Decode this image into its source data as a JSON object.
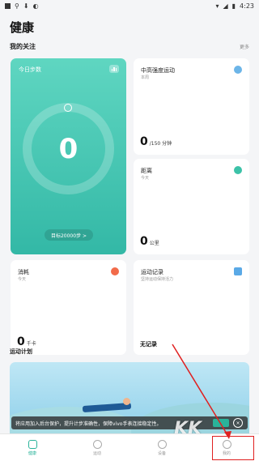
{
  "status_bar": {
    "time": "4:23"
  },
  "header": {
    "title": "健康"
  },
  "my_focus": {
    "title": "我的关注",
    "more": "更多"
  },
  "steps_card": {
    "title": "今日步数",
    "value": "0",
    "goal": "目标20000步 >"
  },
  "intensity_card": {
    "title": "中高强度运动",
    "subtitle": "本周",
    "value": "0",
    "unit": "/150 分钟"
  },
  "distance_card": {
    "title": "距离",
    "subtitle": "今天",
    "value": "0",
    "unit": "公里"
  },
  "calories_card": {
    "title": "消耗",
    "subtitle": "今天",
    "value": "0",
    "unit": "千卡"
  },
  "workout_card": {
    "title": "运动记录",
    "subtitle": "坚持运动保持活力",
    "value": "无记录"
  },
  "plan": {
    "title": "运动计划"
  },
  "toast": {
    "message": "将应用加入后台保护，提升计步准确性，保障vivo手表连接稳定性。"
  },
  "bottom_nav": {
    "items": [
      {
        "label": "健康",
        "icon": "heart-pulse-icon"
      },
      {
        "label": "运动",
        "icon": "runner-icon"
      },
      {
        "label": "设备",
        "icon": "watch-icon"
      },
      {
        "label": "我的",
        "icon": "person-icon"
      }
    ]
  },
  "watermark": {
    "text": "KK"
  },
  "colors": {
    "accent": "#2ab39a",
    "steps_gradient_top": "#5fd6c1",
    "annotation": "#e02020"
  }
}
